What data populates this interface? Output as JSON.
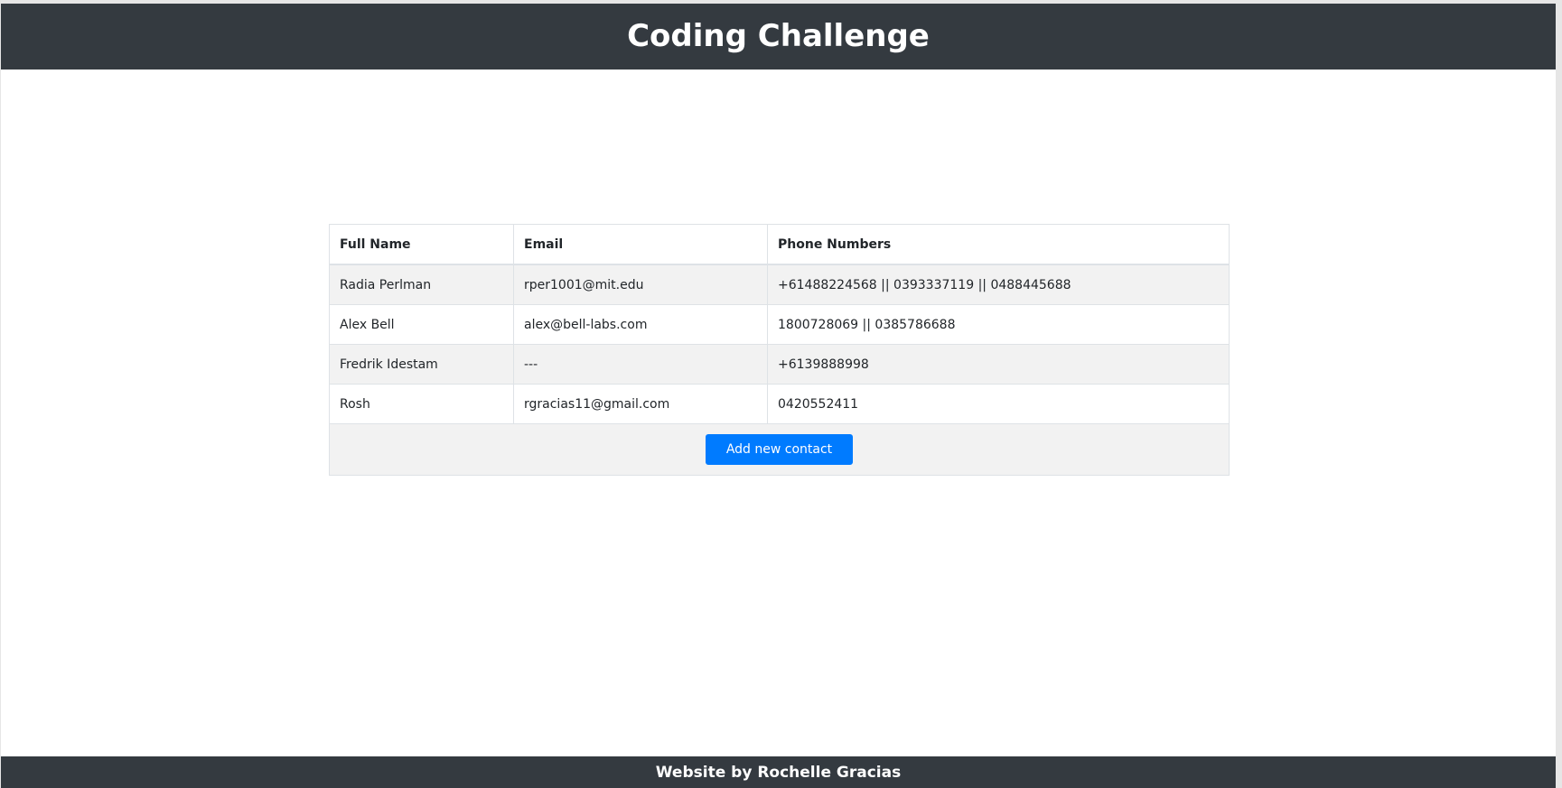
{
  "header": {
    "title": "Coding Challenge"
  },
  "contacts_table": {
    "columns": [
      "Full Name",
      "Email",
      "Phone Numbers"
    ],
    "rows": [
      {
        "full_name": "Radia Perlman",
        "email": "rper1001@mit.edu",
        "phones": "+61488224568 || 0393337119 || 0488445688"
      },
      {
        "full_name": "Alex Bell",
        "email": "alex@bell-labs.com",
        "phones": "1800728069 || 0385786688"
      },
      {
        "full_name": "Fredrik Idestam",
        "email": "---",
        "phones": "+6139888998"
      },
      {
        "full_name": "Rosh",
        "email": "rgracias11@gmail.com",
        "phones": "0420552411"
      }
    ],
    "add_button_label": "Add new contact"
  },
  "footer": {
    "text": "Website by Rochelle Gracias"
  },
  "colors": {
    "header_bg": "#343a40",
    "footer_bg": "#343a40",
    "button_bg": "#007bff",
    "stripe_bg": "#f2f2f2"
  }
}
